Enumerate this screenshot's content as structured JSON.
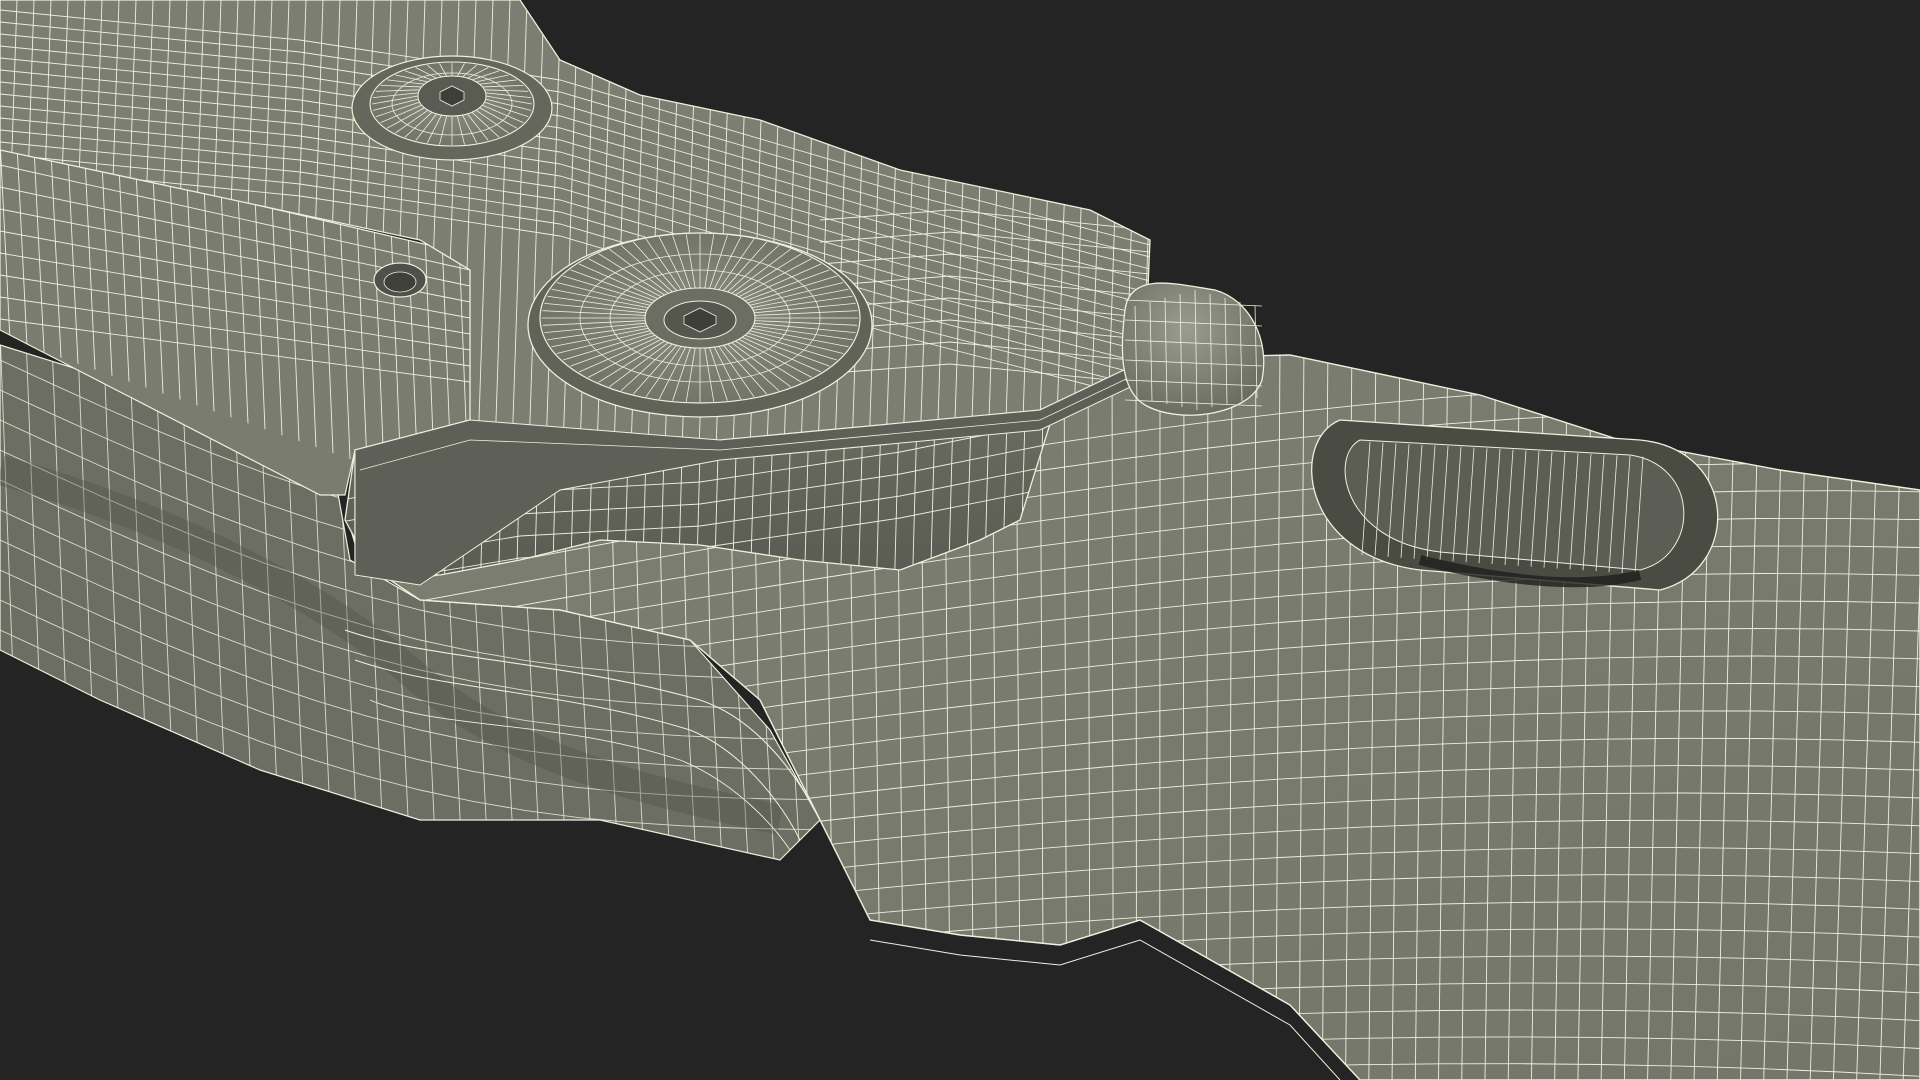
{
  "scene": {
    "subject": "folding-knife-wireframe-render",
    "colors": {
      "background": "#242424",
      "surface": "#7b7d70",
      "surface_light": "#8a8c7f",
      "surface_dark": "#5f6157",
      "shadow_face": "#55574e",
      "wire": "#efefdc"
    }
  }
}
